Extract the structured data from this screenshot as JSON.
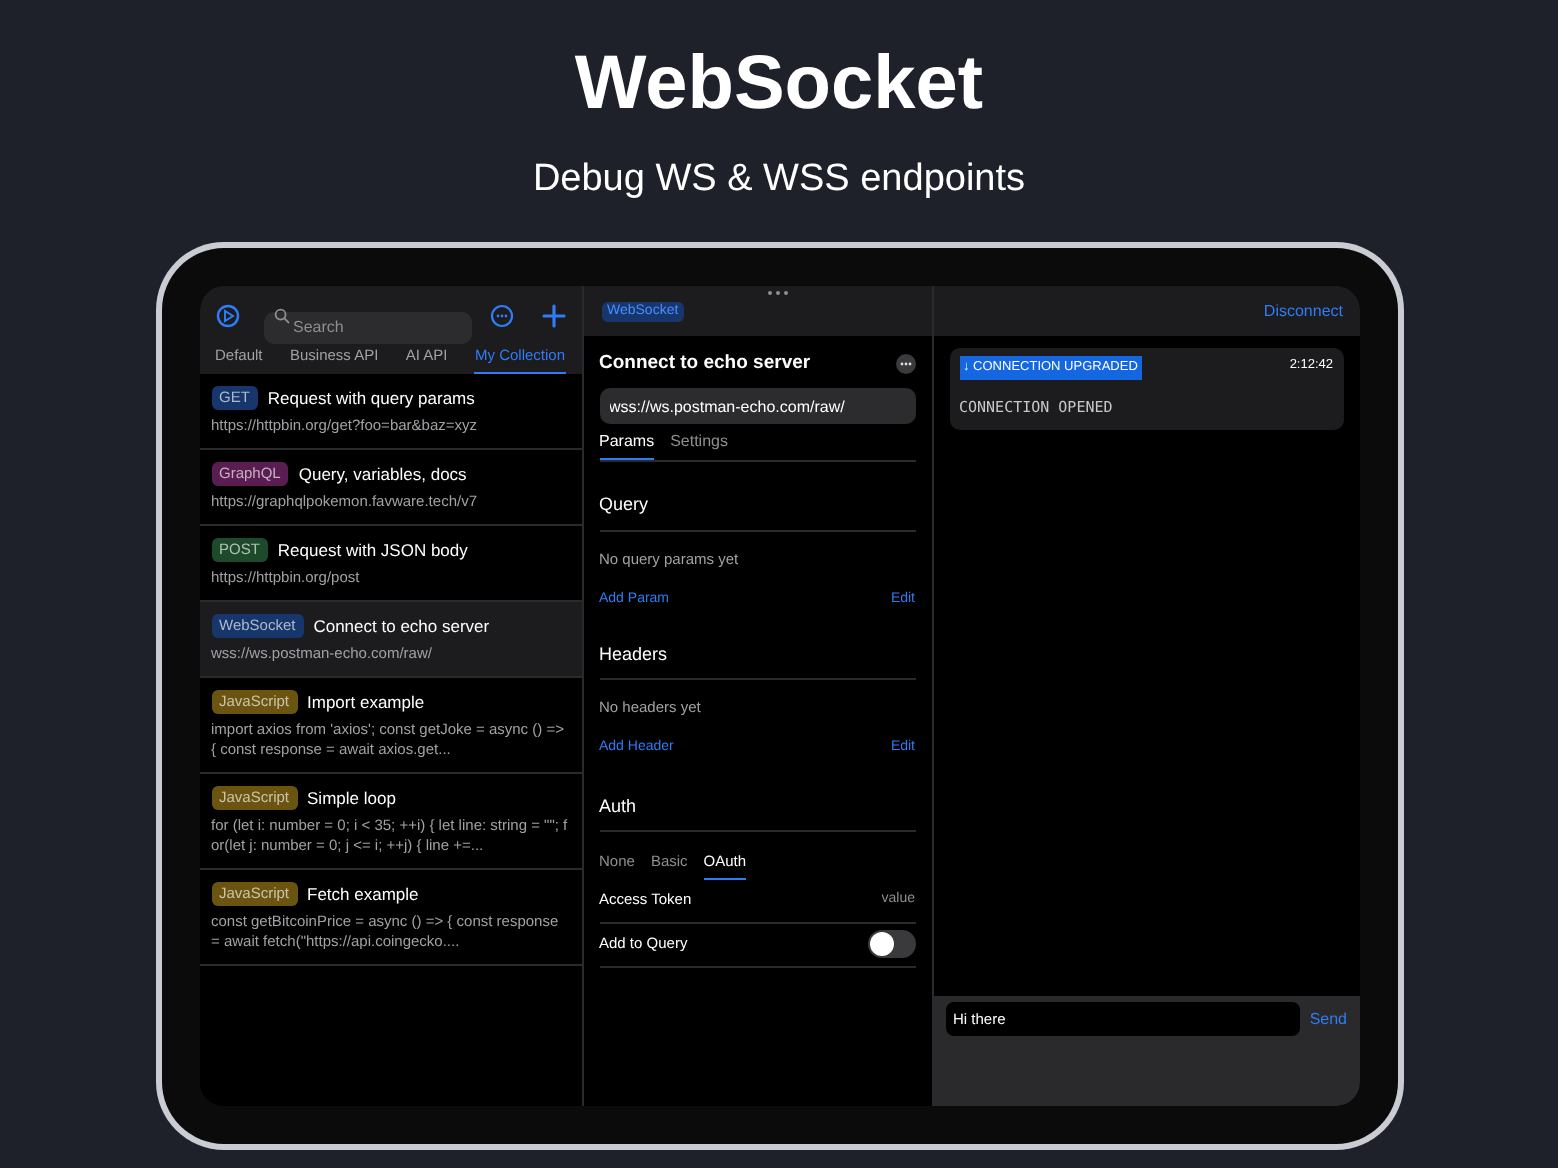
{
  "hero": {
    "title": "WebSocket",
    "subtitle": "Debug WS & WSS endpoints"
  },
  "sidebar": {
    "search": {
      "placeholder": "Search"
    },
    "tabs": [
      {
        "label": "Default",
        "selected": false
      },
      {
        "label": "Business API",
        "selected": false
      },
      {
        "label": "AI API",
        "selected": false
      },
      {
        "label": "My Collection",
        "selected": true
      }
    ],
    "items": [
      {
        "tag": "GET",
        "color": "#17366b",
        "title": "Request with query params",
        "subtitle": "https://httpbin.org/get?foo=bar&baz=xyz",
        "selected": false
      },
      {
        "tag": "GraphQL",
        "color": "#5a1d52",
        "title": "Query, variables, docs",
        "subtitle": "https://graphqlpokemon.favware.tech/v7",
        "selected": false
      },
      {
        "tag": "POST",
        "color": "#1d4a2b",
        "title": "Request with JSON body",
        "subtitle": "https://httpbin.org/post",
        "selected": false
      },
      {
        "tag": "WebSocket",
        "color": "#17366b",
        "title": "Connect to echo server",
        "subtitle": "wss://ws.postman-echo.com/raw/",
        "selected": true
      },
      {
        "tag": "JavaScript",
        "color": "#6b5410",
        "title": "Import example",
        "subtitle": "import axios from 'axios'; const getJoke = async () => { const response = await axios.get...",
        "selected": false
      },
      {
        "tag": "JavaScript",
        "color": "#6b5410",
        "title": "Simple loop",
        "subtitle": "for (let i: number = 0; i < 35; ++i) { let line: string = \"\"; for(let j: number = 0; j <= i; ++j) { line +=...",
        "selected": false
      },
      {
        "tag": "JavaScript",
        "color": "#6b5410",
        "title": "Fetch example",
        "subtitle": "const getBitcoinPrice = async () => { const response = await fetch(\"https://api.coingecko....",
        "selected": false
      }
    ]
  },
  "request": {
    "badge": "WebSocket",
    "title": "Connect to echo server",
    "url": "wss://ws.postman-echo.com/raw/",
    "tabs": [
      {
        "label": "Params",
        "selected": true
      },
      {
        "label": "Settings",
        "selected": false
      }
    ],
    "sections": [
      {
        "title": "Query",
        "empty": "No query params yet",
        "add": "Add Param",
        "edit": "Edit"
      },
      {
        "title": "Headers",
        "empty": "No headers yet",
        "add": "Add Header",
        "edit": "Edit"
      }
    ],
    "auth": {
      "title": "Auth",
      "tabs": [
        {
          "label": "None",
          "selected": false
        },
        {
          "label": "Basic",
          "selected": false
        },
        {
          "label": "OAuth",
          "selected": true
        }
      ],
      "rows": [
        {
          "kind": "text",
          "label": "Access Token",
          "value": "value"
        },
        {
          "kind": "toggle",
          "label": "Add to Query",
          "on": false
        }
      ]
    }
  },
  "messages": {
    "action": "Disconnect",
    "items": [
      {
        "tag": "↓ CONNECTION UPGRADED",
        "time": "2:12:42",
        "body": "CONNECTION OPENED"
      }
    ],
    "composer": {
      "value": "Hi there",
      "send": "Send"
    }
  }
}
